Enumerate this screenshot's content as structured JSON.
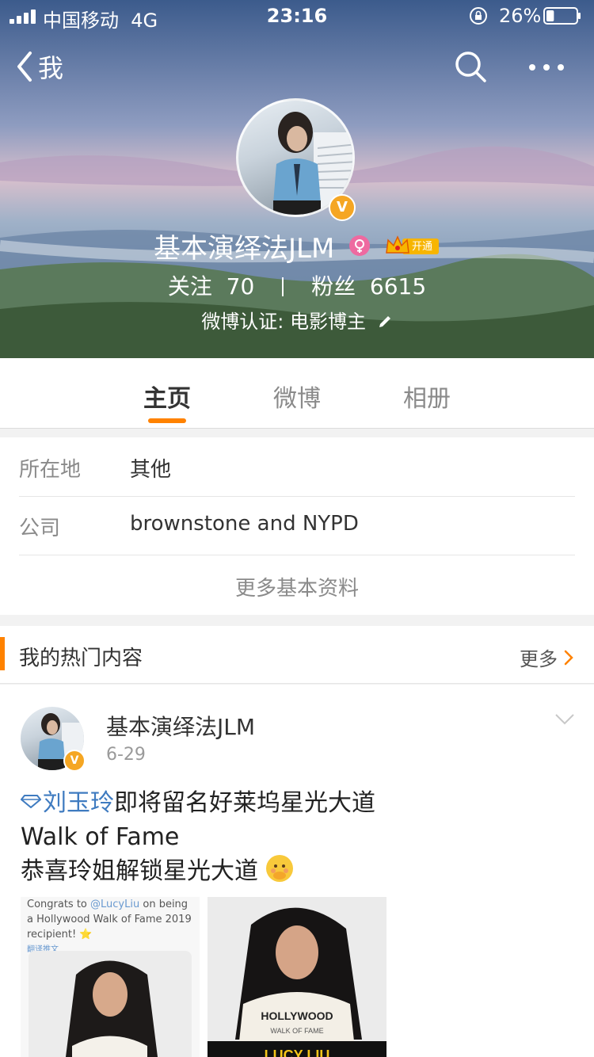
{
  "status_bar": {
    "carrier": "中国移动",
    "network": "4G",
    "time": "23:16",
    "battery_percent": "26%",
    "battery_level": 0.26
  },
  "nav": {
    "back_label": "我"
  },
  "profile": {
    "name": "基本演绎法JLM",
    "vip_label": "开通",
    "following_label": "关注",
    "following_count": "70",
    "fans_label": "粉丝",
    "fans_count": "6615",
    "verification": "微博认证: 电影博主"
  },
  "tabs": [
    {
      "label": "主页",
      "active": true
    },
    {
      "label": "微博",
      "active": false
    },
    {
      "label": "相册",
      "active": false
    }
  ],
  "info": {
    "rows": [
      {
        "key": "所在地",
        "value": "其他"
      },
      {
        "key": "公司",
        "value": "brownstone and NYPD"
      }
    ],
    "more_label": "更多基本资料"
  },
  "hot": {
    "title": "我的热门内容",
    "more_label": "更多"
  },
  "post": {
    "author": "基本演绎法JLM",
    "date": "6-29",
    "mention": "刘玉玲",
    "line1_rest": "即将留名好莱坞星光大道",
    "line2": "Walk of Fame",
    "line3": "恭喜玲姐解锁星光大道",
    "image1_caption_a": "Congrats to ",
    "image1_caption_mention": "@LucyLiu",
    "image1_caption_b": " on being a Hollywood Walk of Fame 2019 recipient! ⭐",
    "image1_translate": "翻译推文",
    "image_shirt_text": "HOLLYWOOD",
    "image_shirt_sub": "WALK OF FAME",
    "image2_banner": "LUCY LIU"
  },
  "colors": {
    "accent": "#ff8200",
    "verified": "#f5a623",
    "link": "#3f7bc0"
  }
}
